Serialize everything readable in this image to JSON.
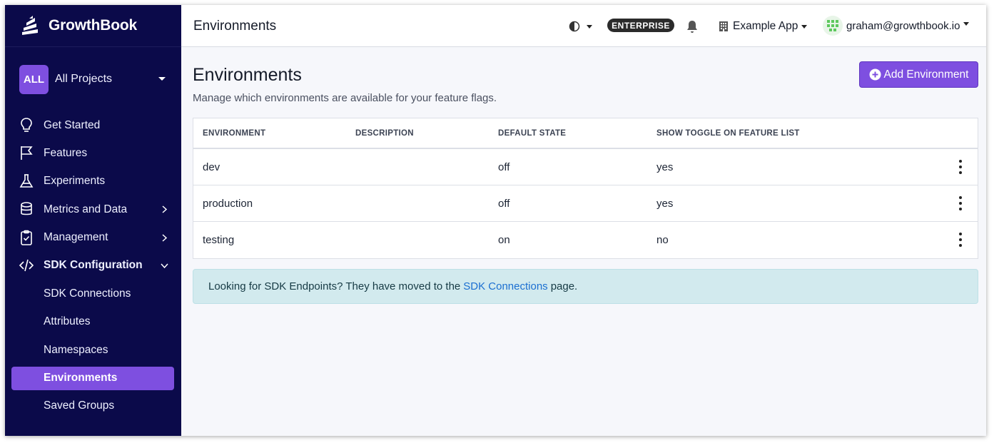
{
  "app": {
    "name": "GrowthBook"
  },
  "project": {
    "badge": "ALL",
    "label": "All Projects"
  },
  "nav": {
    "items": [
      {
        "label": "Get Started"
      },
      {
        "label": "Features"
      },
      {
        "label": "Experiments"
      },
      {
        "label": "Metrics and Data"
      },
      {
        "label": "Management"
      },
      {
        "label": "SDK Configuration"
      }
    ],
    "sub_items": [
      {
        "label": "SDK Connections"
      },
      {
        "label": "Attributes"
      },
      {
        "label": "Namespaces"
      },
      {
        "label": "Environments",
        "active": true
      },
      {
        "label": "Saved Groups"
      }
    ]
  },
  "topbar": {
    "title": "Environments",
    "plan_badge": "ENTERPRISE",
    "org": "Example App",
    "user": "graham@growthbook.io"
  },
  "page": {
    "title": "Environments",
    "subtitle": "Manage which environments are available for your feature flags.",
    "add_button": "Add Environment"
  },
  "table": {
    "headers": [
      "ENVIRONMENT",
      "DESCRIPTION",
      "DEFAULT STATE",
      "SHOW TOGGLE ON FEATURE LIST"
    ],
    "rows": [
      {
        "environment": "dev",
        "description": "",
        "default_state": "off",
        "show_toggle": "yes"
      },
      {
        "environment": "production",
        "description": "",
        "default_state": "off",
        "show_toggle": "yes"
      },
      {
        "environment": "testing",
        "description": "",
        "default_state": "on",
        "show_toggle": "no"
      }
    ]
  },
  "alert": {
    "before": "Looking for SDK Endpoints? They have moved to the",
    "link": "SDK Connections",
    "after": "page."
  },
  "colors": {
    "sidebar_bg": "#0b0a4a",
    "accent": "#7e4fe0",
    "alert_bg": "#d2eaee",
    "link": "#1b6fd1"
  },
  "icons": [
    "growthbook-logo",
    "chevron-down-icon",
    "lightbulb-icon",
    "flag-icon",
    "flask-icon",
    "database-icon",
    "clipboard-check-icon",
    "code-icon",
    "chevron-right-icon",
    "half-circle-theme-icon",
    "bell-icon",
    "building-icon",
    "avatar-identicon",
    "plus-circle-icon",
    "kebab-menu-icon"
  ]
}
